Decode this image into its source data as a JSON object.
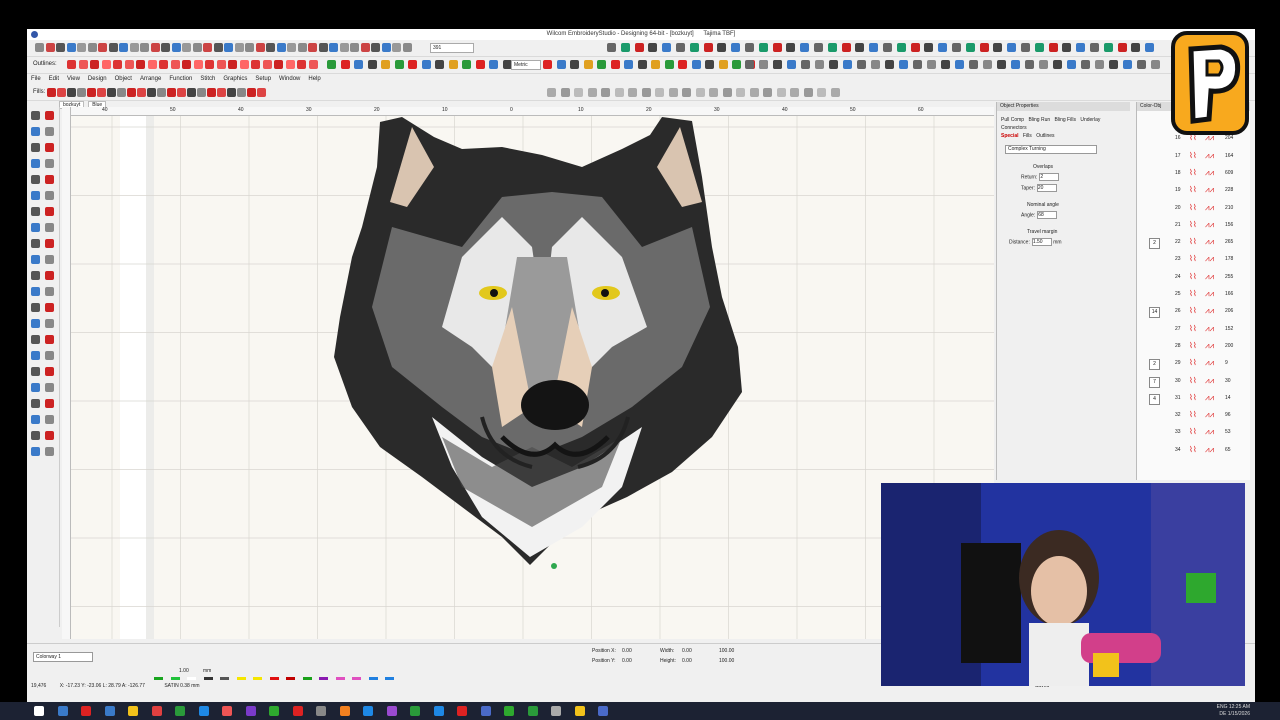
{
  "window": {
    "title": "Wilcom EmbroideryStudio - Designing 64-bit - [bozkuyt]",
    "machine": "Tajima TBF]"
  },
  "menu": [
    "File",
    "Edit",
    "View",
    "Design",
    "Object",
    "Arrange",
    "Function",
    "Stitch",
    "Graphics",
    "Setup",
    "Window",
    "Help"
  ],
  "toolbar": {
    "outlines_label": "Outlines:",
    "fills_label": "Fills:",
    "units_select": "Metric",
    "zoom_value": "391"
  },
  "doc_tabs": [
    "bozkuyt",
    "Blue"
  ],
  "ruler_labels": [
    "40",
    "50",
    "40",
    "30",
    "20",
    "10",
    "0",
    "10",
    "20",
    "30",
    "40",
    "50",
    "60"
  ],
  "object_properties": {
    "title": "Object Properties",
    "tabs": [
      "Pull Comp",
      "Bling Run",
      "Bling Fills",
      "Underlay",
      "Connectors",
      "Special",
      "Fills",
      "Outlines"
    ],
    "mode": "Complex Turning",
    "overlaps_label": "Overlaps",
    "return_label": "Return:",
    "return_value": "2",
    "taper_label": "Taper:",
    "taper_value": "20",
    "nominal_angle_label": "Nominal angle",
    "angle_label": "Angle:",
    "angle_value": "68",
    "travel_margin_label": "Travel margin",
    "distance_label": "Distance:",
    "distance_value": "1.50",
    "distance_unit": "mm"
  },
  "color_objects": {
    "title": "Color-Obj",
    "rows": [
      {
        "n": "15",
        "v": "201",
        "g": ""
      },
      {
        "n": "16",
        "v": "204",
        "g": ""
      },
      {
        "n": "17",
        "v": "164",
        "g": ""
      },
      {
        "n": "18",
        "v": "609",
        "g": ""
      },
      {
        "n": "19",
        "v": "228",
        "g": ""
      },
      {
        "n": "20",
        "v": "210",
        "g": ""
      },
      {
        "n": "21",
        "v": "156",
        "g": ""
      },
      {
        "n": "22",
        "v": "265",
        "g": "2"
      },
      {
        "n": "23",
        "v": "178",
        "g": ""
      },
      {
        "n": "24",
        "v": "255",
        "g": ""
      },
      {
        "n": "25",
        "v": "166",
        "g": ""
      },
      {
        "n": "26",
        "v": "206",
        "g": "14"
      },
      {
        "n": "27",
        "v": "152",
        "g": ""
      },
      {
        "n": "28",
        "v": "200",
        "g": ""
      },
      {
        "n": "29",
        "v": "9",
        "g": "2"
      },
      {
        "n": "30",
        "v": "30",
        "g": "7"
      },
      {
        "n": "31",
        "v": "14",
        "g": "4"
      },
      {
        "n": "32",
        "v": "96",
        "g": ""
      },
      {
        "n": "33",
        "v": "53",
        "g": ""
      },
      {
        "n": "34",
        "v": "65",
        "g": ""
      }
    ]
  },
  "bottom": {
    "colorway": "Colorway 1",
    "swatches": [
      {
        "n": "1",
        "c": "#19a51f"
      },
      {
        "n": "2",
        "c": "#20c23a"
      },
      {
        "n": "3",
        "c": "#ffffff"
      },
      {
        "n": "4",
        "c": "#333333"
      },
      {
        "n": "5",
        "c": "#555555"
      },
      {
        "n": "6",
        "c": "#f5e600"
      },
      {
        "n": "7",
        "c": "#f5e600"
      },
      {
        "n": "8",
        "c": "#e01010"
      },
      {
        "n": "9",
        "c": "#c00000"
      },
      {
        "n": "10",
        "c": "#1aa01a"
      },
      {
        "n": "11",
        "c": "#8a1ab0"
      },
      {
        "n": "12",
        "c": "#e050c0"
      },
      {
        "n": "13",
        "c": "#e050c0"
      },
      {
        "n": "14",
        "c": "#2080e0"
      },
      {
        "n": "15",
        "c": "#2080e0"
      }
    ],
    "position_x_label": "Position X:",
    "position_x": "0.00",
    "position_y_label": "Position Y:",
    "position_y": "0.00",
    "width_label": "Width:",
    "width": "0.00",
    "width_pct": "100.00",
    "height_label": "Height:",
    "height": "0.00",
    "height_pct": "100.00",
    "unit": "mm",
    "stitch_len": "1.00"
  },
  "status": {
    "coords": "X: -17.23 Y: -23.06 L: 28.79 A: -126.77",
    "left_num": "19,476",
    "mode": "SATIN 0.38 mm",
    "saved": "Saved"
  },
  "tray": {
    "lang": "ENG",
    "region": "DE",
    "time": "12:25 AM",
    "date": "1/15/2026"
  },
  "colors": {
    "accent_red": "#d22222",
    "canvas_bg": "#f9f7f2",
    "taskbar": "#1c2233"
  }
}
